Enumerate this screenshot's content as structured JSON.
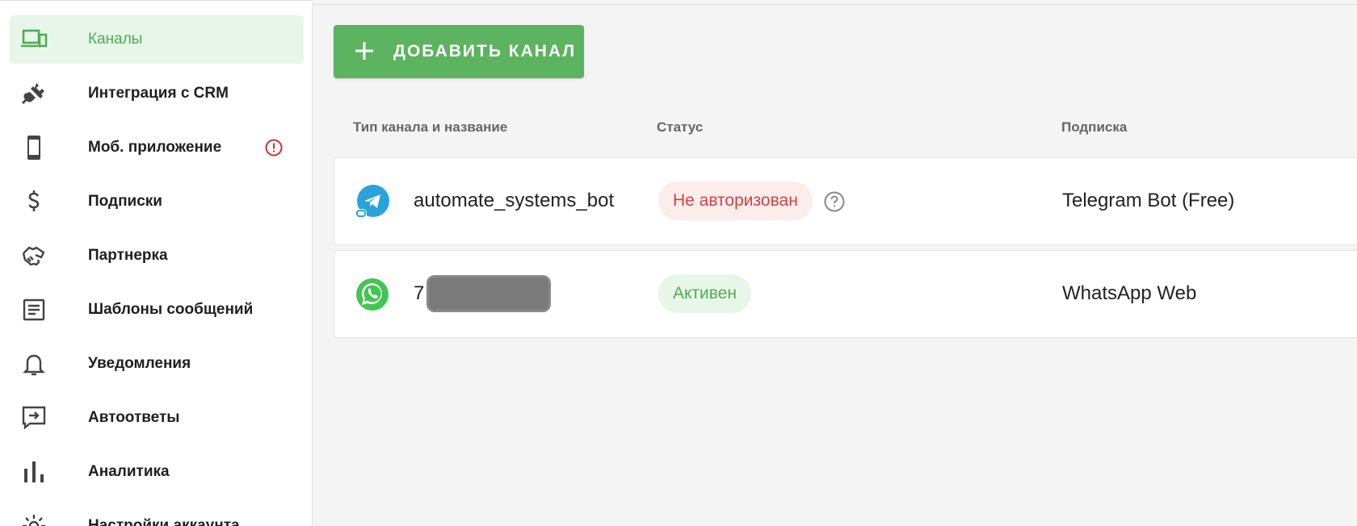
{
  "sidebar": {
    "items": [
      {
        "label": "Каналы",
        "icon": "devices-icon",
        "active": true
      },
      {
        "label": "Интеграция с CRM",
        "icon": "plug-icon"
      },
      {
        "label": "Моб. приложение",
        "icon": "phone-icon",
        "alert": true
      },
      {
        "label": "Подписки",
        "icon": "dollar-icon"
      },
      {
        "label": "Партнерка",
        "icon": "handshake-icon"
      },
      {
        "label": "Шаблоны сообщений",
        "icon": "document-icon"
      },
      {
        "label": "Уведомления",
        "icon": "bell-icon"
      },
      {
        "label": "Автоответы",
        "icon": "reply-icon"
      },
      {
        "label": "Аналитика",
        "icon": "bar-chart-icon"
      },
      {
        "label": "Настройки аккаунта",
        "icon": "gear-icon"
      }
    ]
  },
  "toolbar": {
    "add_channel_label": "ДОБАВИТЬ КАНАЛ"
  },
  "table": {
    "headers": {
      "channel": "Тип канала и название",
      "status": "Статус",
      "subscription": "Подписка"
    },
    "rows": [
      {
        "channel_type": "telegram",
        "name": "automate_systems_bot",
        "status": "Не авторизован",
        "status_kind": "error",
        "subscription": "Telegram Bot (Free)"
      },
      {
        "channel_type": "whatsapp",
        "name": "7",
        "status": "Активен",
        "status_kind": "success",
        "subscription": "WhatsApp Web"
      }
    ]
  },
  "colors": {
    "accent": "#5cb360",
    "accent_text": "#4caf50",
    "active_bg": "#e8f5e9",
    "error": "#d14343",
    "error_bg": "#fdecec",
    "telegram": "#2aa3dd",
    "whatsapp": "#43c553"
  }
}
